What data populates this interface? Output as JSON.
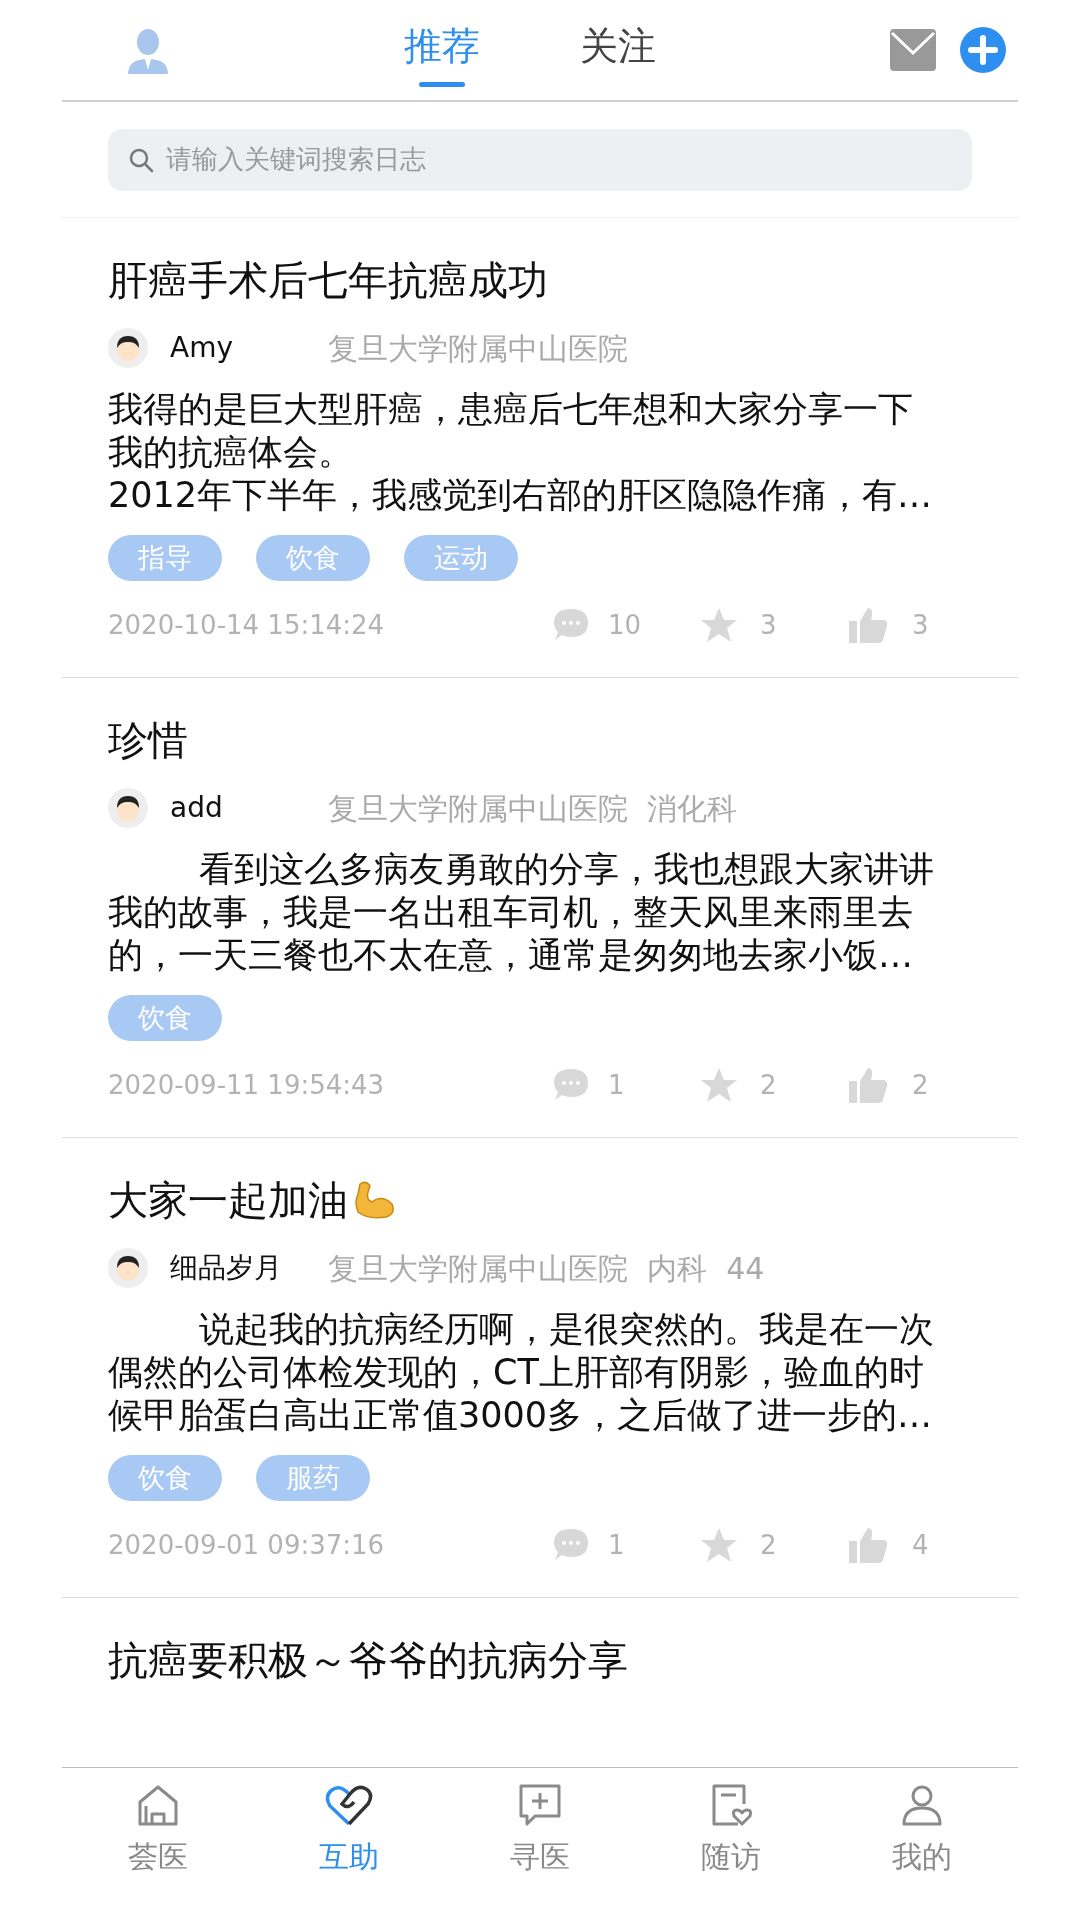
{
  "header": {
    "tabs": [
      {
        "label": "推荐",
        "selected": true
      },
      {
        "label": "关注",
        "selected": false
      }
    ]
  },
  "search": {
    "placeholder": "请输入关键词搜索日志"
  },
  "posts": [
    {
      "title": "肝癌手术后七年抗癌成功",
      "emoji": false,
      "author": "Amy",
      "hospital": "复旦大学附属中山医院",
      "indent": false,
      "body": [
        "我得的是巨大型肝癌，患癌后七年想和大家分享一下我的抗癌体会。",
        "2012年下半年，我感觉到右部的肝区隐隐作痛，有…"
      ],
      "tags": [
        "指导",
        "饮食",
        "运动"
      ],
      "date": "2020-10-14 15:14:24",
      "comments": "10",
      "stars": "3",
      "likes": "3"
    },
    {
      "title": "珍惜",
      "emoji": false,
      "author": "add",
      "hospital": "复旦大学附属中山医院  消化科",
      "indent": true,
      "body": [
        "看到这么多病友勇敢的分享，我也想跟大家讲讲我的故事，我是一名出租车司机，整天风里来雨里去的，一天三餐也不太在意，通常是匆匆地去家小饭…"
      ],
      "tags": [
        "饮食"
      ],
      "date": "2020-09-11 19:54:43",
      "comments": "1",
      "stars": "2",
      "likes": "2"
    },
    {
      "title": "大家一起加油",
      "emoji": true,
      "author": "细品岁月",
      "hospital": "复旦大学附属中山医院  内科  44",
      "indent": true,
      "body": [
        "说起我的抗病经历啊，是很突然的。我是在一次偶然的公司体检发现的，CT上肝部有阴影，验血的时候甲胎蛋白高出正常值3000多，之后做了进一步的…"
      ],
      "tags": [
        "饮食",
        "服药"
      ],
      "date": "2020-09-01 09:37:16",
      "comments": "1",
      "stars": "2",
      "likes": "4"
    },
    {
      "title": "抗癌要积极～爷爷的抗病分享",
      "emoji": false
    }
  ],
  "bottom_nav": [
    {
      "label": "荟医",
      "selected": false
    },
    {
      "label": "互助",
      "selected": true
    },
    {
      "label": "寻医",
      "selected": false
    },
    {
      "label": "随访",
      "selected": false
    },
    {
      "label": "我的",
      "selected": false
    }
  ]
}
